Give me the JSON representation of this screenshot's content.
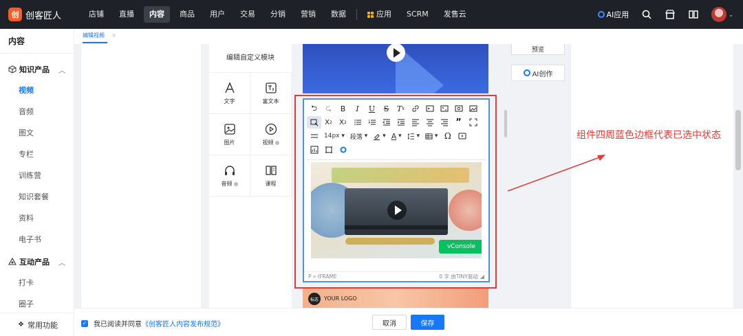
{
  "app": {
    "logo_mark": "创",
    "name": "创客匠人"
  },
  "nav": {
    "items": [
      "店铺",
      "直播",
      "内容",
      "商品",
      "用户",
      "交易",
      "分销",
      "营销",
      "数据"
    ],
    "active_index": 2,
    "apps_label": "应用",
    "scrm_label": "SCRM",
    "after_sale_label": "发售云",
    "ai_app_label": "AI应用"
  },
  "sidebar": {
    "title": "内容",
    "group1": {
      "label": "知识产品",
      "items": [
        "视频",
        "音频",
        "图文",
        "专栏",
        "训练营",
        "知识套餐",
        "资料",
        "电子书"
      ]
    },
    "group2": {
      "label": "互动产品",
      "items": [
        "打卡",
        "圈子"
      ]
    },
    "footer": "常用功能"
  },
  "tab": {
    "label": "编辑视频",
    "close": "×"
  },
  "modules": {
    "title": "编辑自定义模块",
    "cells": [
      {
        "label": "文字",
        "icon": "text-icon",
        "info": false
      },
      {
        "label": "富文本",
        "icon": "rich-text-icon",
        "info": false
      },
      {
        "label": "图片",
        "icon": "image-icon",
        "info": false
      },
      {
        "label": "视频",
        "icon": "video-icon",
        "info": true
      },
      {
        "label": "音频",
        "icon": "headphones-icon",
        "info": true
      },
      {
        "label": "课程",
        "icon": "book-icon",
        "info": false
      }
    ]
  },
  "editor": {
    "row1": [
      "⮌",
      "⮎",
      "B",
      "I",
      "U",
      "S",
      "Tx",
      "🔗",
      "▭",
      "▭",
      "▭",
      "▨"
    ],
    "row2": [
      "▣",
      "X₂",
      "X²",
      "☰",
      "☰",
      "⇤",
      "⇥",
      "≡",
      "≡",
      "≡",
      "99",
      "⤢"
    ],
    "font_size": "14px",
    "paragraph": "段落",
    "status_left": "P » IFRAME",
    "status_right": "0 字 由TINY驱动",
    "vconsole": "vConsole"
  },
  "preview_label": "预览",
  "ai_create_label": "AI创作",
  "annotation": "组件四周蓝色边框代表已选中状态",
  "logo_banner": {
    "badge": "标志",
    "text": "YOUR LOGO"
  },
  "bottom": {
    "agree_prefix": "我已阅读并同意",
    "agree_link": "《创客匠人内容发布规范》",
    "cancel": "取消",
    "save": "保存"
  },
  "colors": {
    "accent": "#1677ff",
    "annotation": "#e53935",
    "nav_bg": "#1e2228"
  }
}
